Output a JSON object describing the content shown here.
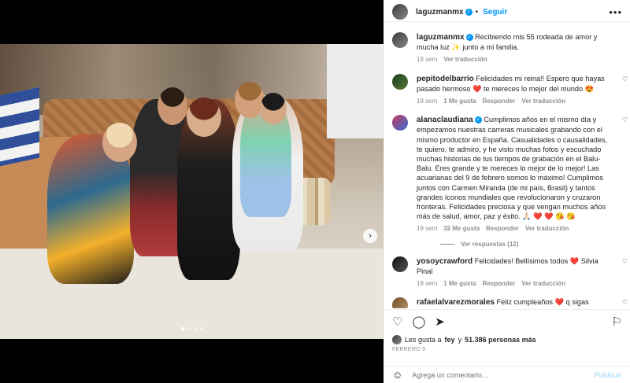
{
  "post": {
    "username": "laguzmanmx",
    "follow_label": "Seguir",
    "more_label": "•••",
    "photo_next_icon": "chevron-right-icon",
    "carousel_count": 4,
    "carousel_active": 1
  },
  "caption": {
    "username": "laguzmanmx",
    "text": "Recibiendo mis 55 rodeada de amor y mucha luz ✨ junto a mi familia.",
    "time": "19 sem",
    "translate": "Ver traducción"
  },
  "comments": [
    {
      "username": "pepitodelbarrio",
      "verified": false,
      "text_a": "Felicidades mi reina!! Espero que hayas pasado hermoso ",
      "text_b": " te mereces lo mejor del mundo 😍",
      "time": "19 sem",
      "likes": "1 Me gusta",
      "reply": "Responder",
      "translate": "Ver traducción"
    },
    {
      "username": "alanaclaudiana",
      "verified": true,
      "text": "Cumplimos años en el mismo día y empezamos nuestras carreras musicales grabando con el mismo productor en España. Casualidades o causalidades, te quiero, te admiro, y he visto muchas fotos y escuchado muchas historias de tus tiempos de grabación en el Balu-Balu. Eres grande y te mereces lo mejor de lo mejor! Las acuarianas del 9 de febrero somos lo máximo! Cumplimos juntos con Carmen Miranda (de mi país, Brasil) y tantos grandes íconos mundiales que revolucionaron y cruzaron fronteras. Felicidades preciosa y que vengan muchos años más de salud, amor, paz y éxito. 🙏🏻 ❤️ ❤️ 😘 😘",
      "time": "19 sem",
      "likes": "32 Me gusta",
      "reply": "Responder",
      "translate": "Ver traducción",
      "replies_label": "Ver respuestas (12)"
    },
    {
      "username": "yosoycrawford",
      "verified": false,
      "text_a": "Felicidades! Bellísimos todos ",
      "text_b": " Silvia Pinal",
      "time": "19 sem",
      "likes": "1 Me gusta",
      "reply": "Responder",
      "translate": "Ver traducción"
    },
    {
      "username": "rafaelalvarezmorales",
      "verified": false,
      "text": "Feliz cumpleaños ❤️ q sigas cumpliendo muchos años más y q te la pases chevere hoy en tu día en"
    }
  ],
  "actions": {
    "like_icon": "heart-icon",
    "comment_icon": "comment-icon",
    "share_icon": "send-icon",
    "save_icon": "bookmark-icon",
    "likes_prefix": "Les gusta a ",
    "likes_user": "fey",
    "likes_middle": " y ",
    "likes_count": "51.386 personas más",
    "date": "FEBRERO 9"
  },
  "add_comment": {
    "placeholder": "Agrega un comentario...",
    "post_label": "Publicar"
  },
  "colors": {
    "accent": "#0095f6",
    "heart_red": "#ed4956",
    "muted": "#8e8e8e"
  }
}
